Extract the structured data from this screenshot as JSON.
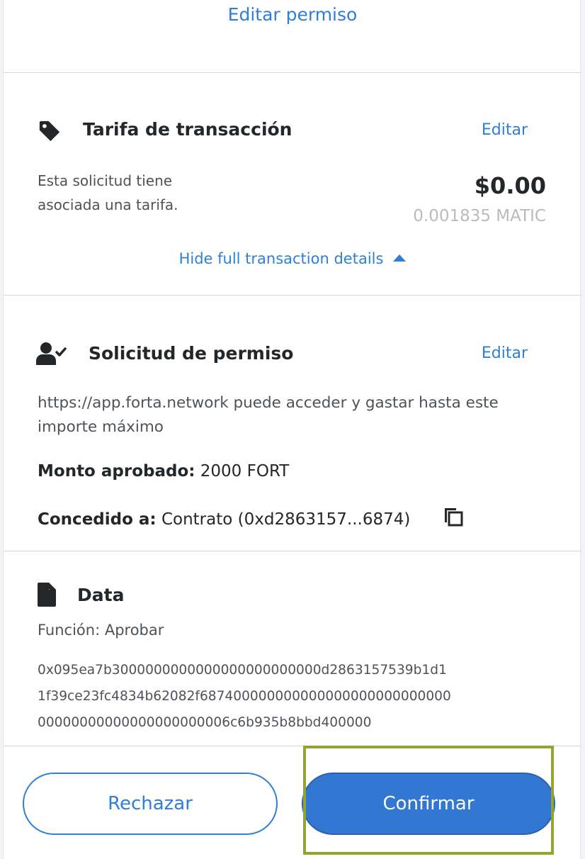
{
  "top_link": "Editar permiso",
  "fee_section": {
    "title": "Tarifa de transacción",
    "edit_label": "Editar",
    "description_line1": "Esta solicitud tiene",
    "description_line2": "asociada una tarifa.",
    "usd_amount": "$0.00",
    "native_amount": "0.001835 MATIC",
    "toggle_details": "Hide full transaction details"
  },
  "permission_section": {
    "title": "Solicitud de permiso",
    "edit_label": "Editar",
    "description_line1": "https://app.forta.network puede acceder y gastar hasta este",
    "description_line2": "importe máximo",
    "approved_label": "Monto aprobado:",
    "approved_value": "2000 FORT",
    "granted_label": "Concedido a:",
    "granted_value": "Contrato (0xd2863157...6874)"
  },
  "data_section": {
    "title": "Data",
    "function_label": "Función: Aprobar",
    "hex_line1": "0x095ea7b3000000000000000000000000d2863157539b1d1",
    "hex_line2": "1f39ce23fc4834b62082f687400000000000000000000000000",
    "hex_line3": "00000000000000000000006c6b935b8bbd400000"
  },
  "buttons": {
    "reject": "Rechazar",
    "confirm": "Confirmar"
  },
  "colors": {
    "accent": "#2f7fd6",
    "confirm_bg": "#3277d2",
    "highlight_border": "#94a52e"
  }
}
